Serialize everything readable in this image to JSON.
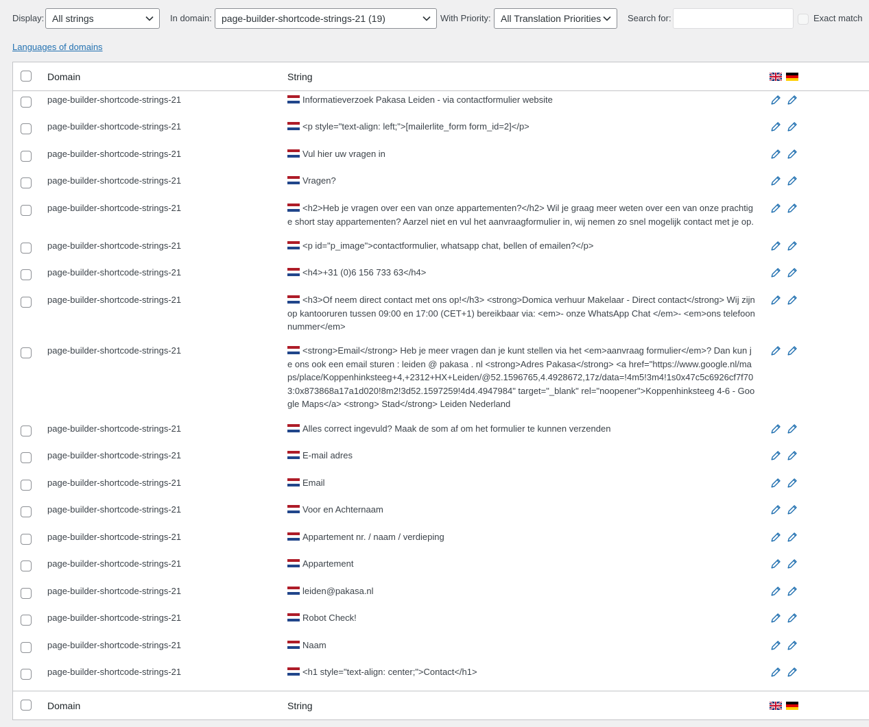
{
  "filters": {
    "display_label": "Display:",
    "display_value": "All strings",
    "domain_label": "In domain:",
    "domain_value": "page-builder-shortcode-strings-21 (19)",
    "priority_label": "With Priority:",
    "priority_value": "All Translation Priorities",
    "search_label": "Search for:",
    "search_value": "",
    "exact_label": "Exact match"
  },
  "languages_link": "Languages of domains",
  "table": {
    "col_domain": "Domain",
    "col_string": "String",
    "rows": [
      {
        "domain": "page-builder-shortcode-strings-21",
        "string": "Informatieverzoek Pakasa Leiden - via contactformulier website"
      },
      {
        "domain": "page-builder-shortcode-strings-21",
        "string": "<p style=\"text-align: left;\">[mailerlite_form form_id=2]</p>"
      },
      {
        "domain": "page-builder-shortcode-strings-21",
        "string": "Vul hier uw vragen in"
      },
      {
        "domain": "page-builder-shortcode-strings-21",
        "string": "Vragen?"
      },
      {
        "domain": "page-builder-shortcode-strings-21",
        "string": "<h2>Heb je vragen over een van onze appartementen?</h2> Wil je graag meer weten over een van onze prachtige short stay appartementen? Aarzel niet en vul het aanvraagformulier in, wij nemen zo snel mogelijk contact met je op."
      },
      {
        "domain": "page-builder-shortcode-strings-21",
        "string": "<p id=\"p_image\">contactformulier, whatsapp chat, bellen of emailen?</p>"
      },
      {
        "domain": "page-builder-shortcode-strings-21",
        "string": "<h4>+31 (0)6 156 733 63</h4>"
      },
      {
        "domain": "page-builder-shortcode-strings-21",
        "string": "<h3>Of neem direct contact met ons op!</h3> <strong>Domica verhuur Makelaar - Direct contact</strong> Wij zijn op kantooruren tussen 09:00 en 17:00 (CET+1) bereikbaar via: <em>- onze WhatsApp Chat </em>- <em>ons telefoonnummer</em>"
      },
      {
        "domain": "page-builder-shortcode-strings-21",
        "string": "<strong>Email</strong> Heb je meer vragen dan je kunt stellen via het <em>aanvraag formulier</em>? Dan kun je ons ook een email sturen : leiden @ pakasa . nl <strong>Adres Pakasa</strong> <a href=\"https://www.google.nl/maps/place/Koppenhinksteeg+4,+2312+HX+Leiden/@52.1596765,4.4928672,17z/data=!4m5!3m4!1s0x47c5c6926cf7f703:0x873868a17a1d020!8m2!3d52.1597259!4d4.4947984\" target=\"_blank\" rel=\"noopener\">Koppenhinksteeg 4-6 - Google Maps</a> <strong> Stad</strong> Leiden Nederland"
      },
      {
        "domain": "page-builder-shortcode-strings-21",
        "string": "Alles correct ingevuld? Maak de som af om het formulier te kunnen verzenden"
      },
      {
        "domain": "page-builder-shortcode-strings-21",
        "string": "E-mail adres"
      },
      {
        "domain": "page-builder-shortcode-strings-21",
        "string": "Email"
      },
      {
        "domain": "page-builder-shortcode-strings-21",
        "string": "Voor en Achternaam"
      },
      {
        "domain": "page-builder-shortcode-strings-21",
        "string": "Appartement nr. / naam / verdieping"
      },
      {
        "domain": "page-builder-shortcode-strings-21",
        "string": "Appartement"
      },
      {
        "domain": "page-builder-shortcode-strings-21",
        "string": "leiden@pakasa.nl"
      },
      {
        "domain": "page-builder-shortcode-strings-21",
        "string": "Robot Check!"
      },
      {
        "domain": "page-builder-shortcode-strings-21",
        "string": "Naam"
      },
      {
        "domain": "page-builder-shortcode-strings-21",
        "string": "<h1 style=\"text-align: center;\">Contact</h1>"
      }
    ]
  },
  "icons": {
    "source_flag": "nl-flag-icon",
    "target_flags": [
      "uk-flag-icon",
      "de-flag-icon"
    ],
    "edit": "pencil-icon"
  },
  "colors": {
    "link": "#2271b1",
    "pencil": "#2271b1",
    "background": "#f0f0f1",
    "border": "#c3c4c7"
  }
}
